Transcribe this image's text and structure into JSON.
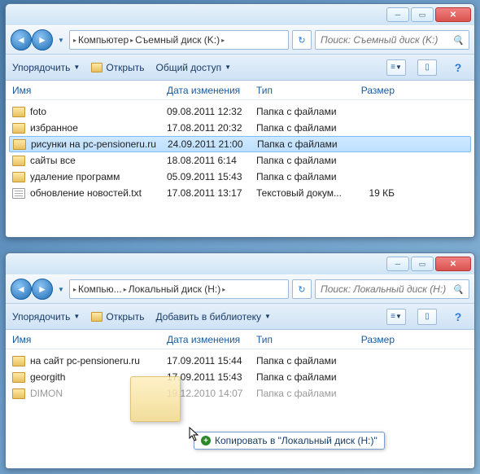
{
  "window1": {
    "breadcrumb": [
      "Компьютер",
      "Съемный диск (K:)"
    ],
    "search_placeholder": "Поиск: Съемный диск (K:)",
    "toolbar": {
      "organize": "Упорядочить",
      "open": "Открыть",
      "share": "Общий доступ"
    },
    "headers": {
      "name": "Имя",
      "date": "Дата изменения",
      "type": "Тип",
      "size": "Размер"
    },
    "items": [
      {
        "name": "foto",
        "date": "09.08.2011 12:32",
        "type": "Папка с файлами",
        "size": "",
        "icon": "folder"
      },
      {
        "name": "избранное",
        "date": "17.08.2011 20:32",
        "type": "Папка с файлами",
        "size": "",
        "icon": "folder"
      },
      {
        "name": "рисунки на pc-pensioneru.ru",
        "date": "24.09.2011 21:00",
        "type": "Папка с файлами",
        "size": "",
        "icon": "folder",
        "selected": true
      },
      {
        "name": "сайты все",
        "date": "18.08.2011 6:14",
        "type": "Папка с файлами",
        "size": "",
        "icon": "folder"
      },
      {
        "name": "удаление программ",
        "date": "05.09.2011 15:43",
        "type": "Папка с файлами",
        "size": "",
        "icon": "folder"
      },
      {
        "name": "обновление новостей.txt",
        "date": "17.08.2011 13:17",
        "type": "Текстовый докум...",
        "size": "19 КБ",
        "icon": "txt"
      }
    ]
  },
  "window2": {
    "breadcrumb": [
      "Компью...",
      "Локальный диск (H:)"
    ],
    "search_placeholder": "Поиск: Локальный диск (H:)",
    "toolbar": {
      "organize": "Упорядочить",
      "open": "Открыть",
      "library": "Добавить в библиотеку"
    },
    "headers": {
      "name": "Имя",
      "date": "Дата изменения",
      "type": "Тип",
      "size": "Размер"
    },
    "items": [
      {
        "name": "на сайт pc-pensioneru.ru",
        "date": "17.09.2011 15:44",
        "type": "Папка с файлами",
        "size": "",
        "icon": "folder"
      },
      {
        "name": "georgith",
        "date": "17.09.2011 15:43",
        "type": "Папка с файлами",
        "size": "",
        "icon": "folder"
      },
      {
        "name": "DIMON",
        "date": "19.12.2010 14:07",
        "type": "Папка с файлами",
        "size": "",
        "icon": "folder",
        "faded": true
      }
    ]
  },
  "copy_tooltip": "Копировать в \"Локальный диск (H:)\""
}
